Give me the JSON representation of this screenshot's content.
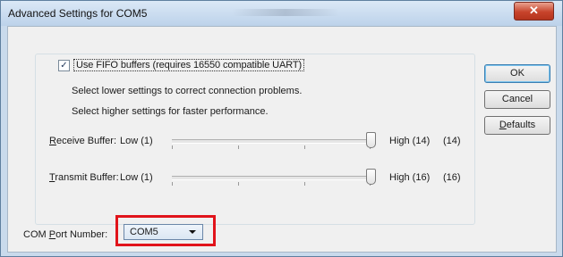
{
  "window": {
    "title": "Advanced Settings for COM5",
    "close_glyph": "✕"
  },
  "fifo": {
    "checked": true,
    "label": "Use FIFO buffers (requires 16550 compatible UART)"
  },
  "info": {
    "line1": "Select lower settings to correct connection problems.",
    "line2": "Select higher settings for faster performance."
  },
  "receive": {
    "label_prefix": "R",
    "label_rest": "eceive Buffer:",
    "low_label": "Low (1)",
    "high_label": "High (14)",
    "value_label": "(14)",
    "min": 1,
    "max": 14,
    "value": 14
  },
  "transmit": {
    "label_prefix": "T",
    "label_rest": "ransmit Buffer:",
    "low_label": "Low (1)",
    "high_label": "High (16)",
    "value_label": "(16)",
    "min": 1,
    "max": 16,
    "value": 16
  },
  "buttons": {
    "ok": "OK",
    "cancel": "Cancel",
    "defaults_prefix": "D",
    "defaults_rest": "efaults"
  },
  "com_port": {
    "label_pre": "COM ",
    "label_u": "P",
    "label_post": "ort Number:",
    "selected": "COM5"
  },
  "colors": {
    "highlight": "#e1141b",
    "close_button": "#c7432b"
  }
}
